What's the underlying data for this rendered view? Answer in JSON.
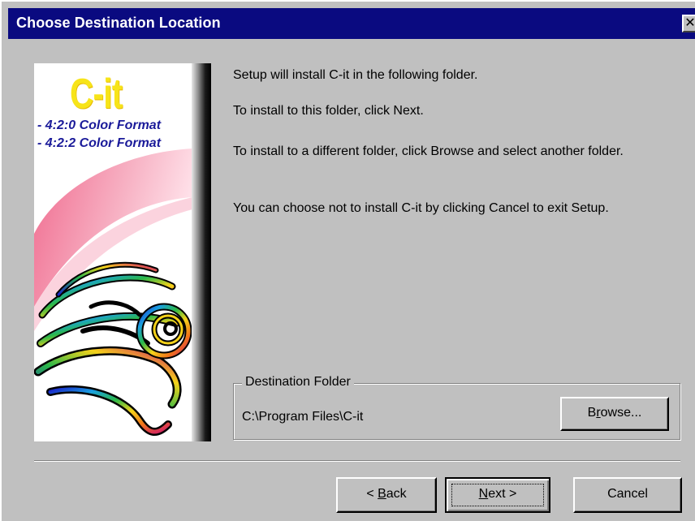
{
  "window": {
    "title": "Choose Destination Location",
    "close_glyph": "✕"
  },
  "banner": {
    "logo": "C-it",
    "features": [
      "- 4:2:0 Color Format",
      "- 4:2:2 Color Format"
    ],
    "colors": {
      "logo": "#f7e419",
      "features": "#1b1b9a",
      "swoosh": "#f2a0b8"
    }
  },
  "content": {
    "line1": "Setup will install C-it in the following folder.",
    "line2": "To install to this folder, click Next.",
    "line3": "To install to a different folder, click Browse and select another folder.",
    "line4": "You can choose not to install C-it by clicking Cancel to exit Setup."
  },
  "destination": {
    "group_label": "Destination Folder",
    "path": "C:\\Program Files\\C-it",
    "browse_prefix": "B",
    "browse_mnemonic": "r",
    "browse_suffix": "owse..."
  },
  "buttons": {
    "back_prefix": "< ",
    "back_mnemonic": "B",
    "back_suffix": "ack",
    "next_mnemonic": "N",
    "next_suffix": "ext >",
    "cancel": "Cancel"
  },
  "colors": {
    "titlebar": "#0a0a80",
    "face": "#c0c0c0"
  }
}
